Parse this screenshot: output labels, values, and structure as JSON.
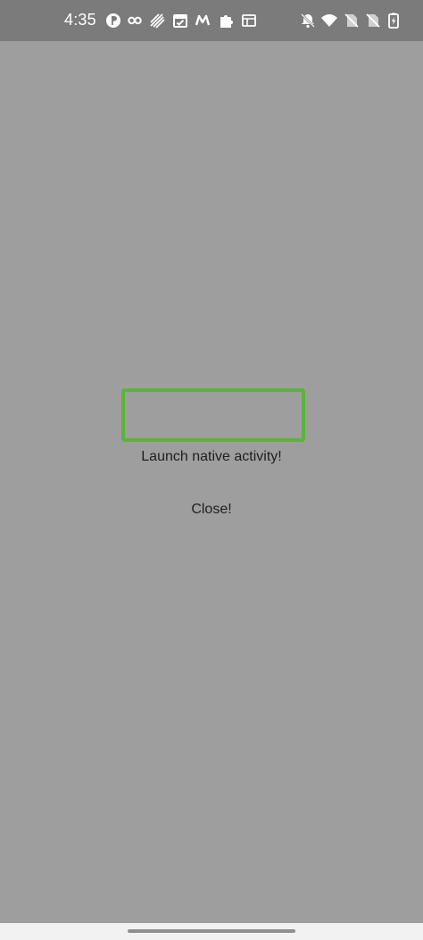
{
  "status_bar": {
    "time": "4:35",
    "left_icons": [
      "p-icon",
      "infinity-icon",
      "signal-stripes-icon",
      "calendar-check-icon",
      "m-logo-icon",
      "puzzle-icon",
      "browser-window-icon"
    ],
    "right_icons": [
      "bell-off-icon",
      "wifi-icon",
      "no-sim-icon",
      "no-sim-2-icon",
      "battery-charging-icon"
    ]
  },
  "main": {
    "launch_label": "Launch native activity!",
    "close_label": "Close!"
  },
  "colors": {
    "status_bar_bg": "#7b7b7b",
    "content_bg": "#9e9e9e",
    "frame_border": "#5cb33a",
    "nav_bar_bg": "#f2f2f2"
  }
}
